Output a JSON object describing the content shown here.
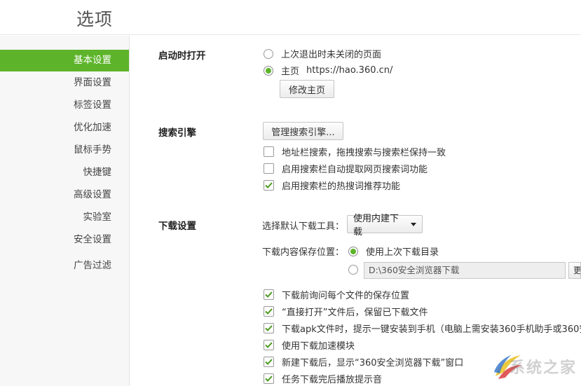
{
  "header": {
    "title": "选项"
  },
  "sidebar": {
    "items": [
      {
        "label": "基本设置",
        "active": true
      },
      {
        "label": "界面设置"
      },
      {
        "label": "标签设置"
      },
      {
        "label": "优化加速"
      },
      {
        "label": "鼠标手势"
      },
      {
        "label": "快捷键"
      },
      {
        "label": "高级设置"
      },
      {
        "label": "实验室"
      },
      {
        "label": "安全设置"
      },
      {
        "label": "广告过滤"
      }
    ]
  },
  "startup": {
    "title": "启动时打开",
    "option_last": "上次退出时未关闭的页面",
    "option_home": "主页",
    "home_url": "https://hao.360.cn/",
    "selected": "option_home",
    "edit_home_button": "修改主页"
  },
  "search": {
    "title": "搜索引擎",
    "manage_button": "管理搜索引擎...",
    "options": [
      {
        "label": "地址栏搜索，拖拽搜索与搜索栏保持一致",
        "checked": false
      },
      {
        "label": "启用搜索栏自动提取网页搜索词功能",
        "checked": false
      },
      {
        "label": "启用搜索栏的热搜词推荐功能",
        "checked": true
      }
    ]
  },
  "download": {
    "title": "下载设置",
    "tool_label": "选择默认下载工具：",
    "tool_value": "使用内建下载",
    "location_label": "下载内容保存位置：",
    "location_last": "使用上次下载目录",
    "location_path": "D:\\360安全浏览器下载",
    "browse_button": "更",
    "options": [
      {
        "label": "下载前询问每个文件的保存位置",
        "checked": true
      },
      {
        "label": "“直接打开”文件后，保留已下载文件",
        "checked": true
      },
      {
        "label": "下载apk文件时，提示一键安装到手机（电脑上需安装360手机助手或360安",
        "checked": true
      },
      {
        "label": "使用下载加速模块",
        "checked": true
      },
      {
        "label": "新建下载后，显示“360安全浏览器下载”窗口",
        "checked": true
      },
      {
        "label": "任务下载完后播放提示音",
        "checked": true
      }
    ]
  },
  "watermark": {
    "text": "系统之家"
  },
  "colors": {
    "accent": "#5db42a",
    "sidebar_bg": "#f7f7f7"
  }
}
